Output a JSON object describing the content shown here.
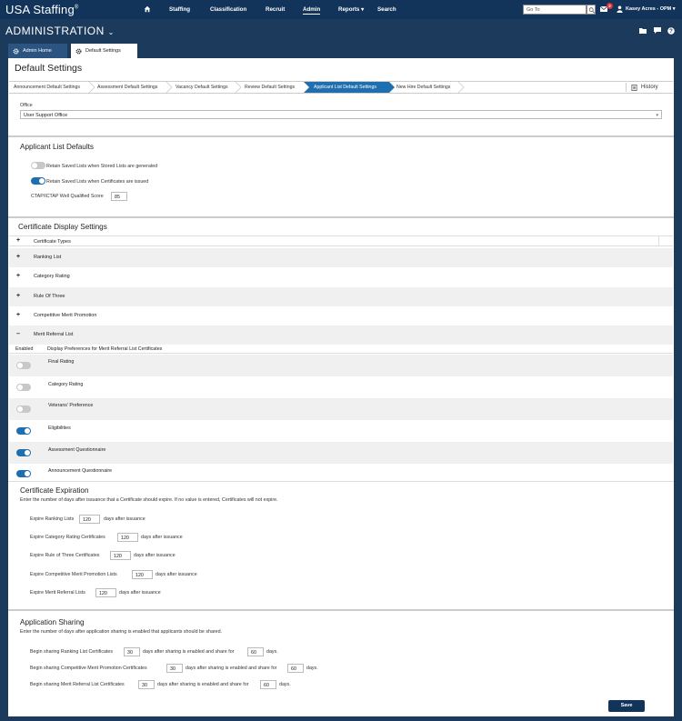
{
  "app": {
    "logo": "USA Staffing",
    "logo_mark": "®"
  },
  "nav": {
    "items": [
      "Staffing",
      "Classification",
      "Recruit",
      "Admin",
      "Reports",
      "Search"
    ],
    "active": "Admin"
  },
  "header": {
    "goto_placeholder": "Go To",
    "mail_count": "2",
    "user": "Kasey Acres - OPM"
  },
  "admin": {
    "title": "ADMINISTRATION"
  },
  "tabs": [
    {
      "label": "Admin Home"
    },
    {
      "label": "Default Settings"
    }
  ],
  "page": {
    "title": "Default Settings"
  },
  "steps": [
    "Announcement Default Settings",
    "Assessment Default Settings",
    "Vacancy Default Settings",
    "Review Default Settings",
    "Applicant List Default Settings",
    "New Hire Default Settings"
  ],
  "history_label": "History",
  "office": {
    "label": "Office",
    "value": "User Support Office"
  },
  "applicant_defaults": {
    "title": "Applicant List Defaults",
    "retain_stored": {
      "label": "Retain Saved Lists when Stored Lists are generated",
      "enabled": false
    },
    "retain_certs": {
      "label": "Retain Saved Lists when Certificates are issued",
      "enabled": true
    },
    "ctap_label": "CTAP/ICTAP Well Qualified Score",
    "ctap_value": "85"
  },
  "cert_display": {
    "title": "Certificate Display Settings",
    "types_header": "Certificate Types",
    "types": [
      "Ranking List",
      "Category Rating",
      "Rule Of Three",
      "Competitive Merit Promotion",
      "Merit Referral List"
    ],
    "enabled_header": "Enabled",
    "prefs_header": "Display Preferences for Merit Referral List Certificates",
    "prefs": [
      {
        "label": "Final Rating",
        "enabled": false
      },
      {
        "label": "Category Rating",
        "enabled": false
      },
      {
        "label": "Veterans' Preference",
        "enabled": false
      },
      {
        "label": "Eligibilities",
        "enabled": true
      },
      {
        "label": "Assessment Questionnaire",
        "enabled": true
      },
      {
        "label": "Announcement Questionnaire",
        "enabled": true
      }
    ]
  },
  "cert_expiration": {
    "title": "Certificate Expiration",
    "desc": "Enter the number of days after issuance that a Certificate should expire. If no value is entered, Certificates will not expire.",
    "suffix": "days after issuance",
    "rows": [
      {
        "label": "Expire Ranking Lists",
        "value": "120"
      },
      {
        "label": "Expire Category Rating Certificates",
        "value": "120"
      },
      {
        "label": "Expire Rule of Three Certificates",
        "value": "120"
      },
      {
        "label": "Expire Competitive Merit Promotion Lists",
        "value": "120"
      },
      {
        "label": "Expire Merit Referral Lists",
        "value": "120"
      }
    ]
  },
  "app_sharing": {
    "title": "Application Sharing",
    "desc": "Enter the number of days after application sharing is enabled that applicants should be shared.",
    "middle": "days after sharing is enabled and share for",
    "end": "days.",
    "rows": [
      {
        "label": "Begin sharing Ranking List Certificates",
        "after": "30",
        "share": "60"
      },
      {
        "label": "Begin sharing Competitive Merit Promotion Certificates",
        "after": "30",
        "share": "60"
      },
      {
        "label": "Begin sharing Merit Referral List Certificates",
        "after": "30",
        "share": "60"
      }
    ]
  },
  "save_label": "Save",
  "colors": {
    "navy": "#12345a",
    "accent": "#1f6fb0"
  }
}
